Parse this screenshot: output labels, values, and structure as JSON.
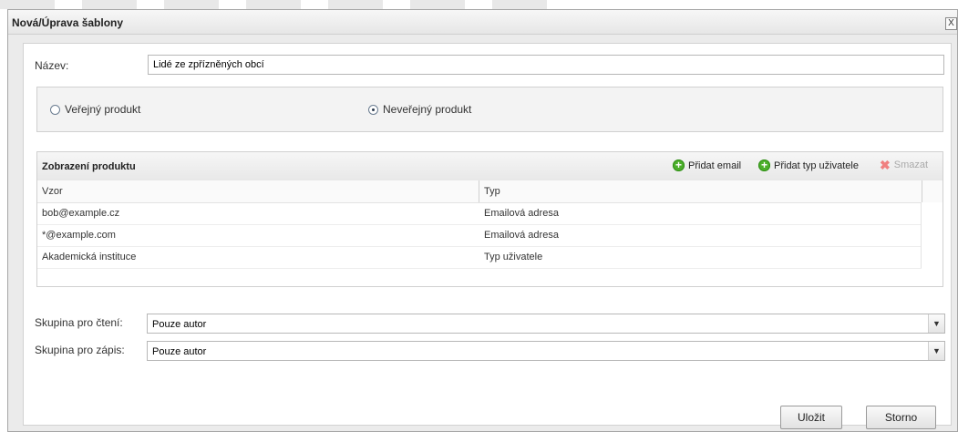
{
  "window": {
    "title": "Nová/Úprava šablony",
    "close_label": "X"
  },
  "form": {
    "name_label": "Název:",
    "name_value": "Lidé ze zpřízněných obcí",
    "radios": [
      {
        "label": "Veřejný produkt",
        "selected": false
      },
      {
        "label": "Neveřejný produkt",
        "selected": true
      }
    ]
  },
  "grid": {
    "title": "Zobrazení produktu",
    "toolbar": {
      "add_email": "Přidat email",
      "add_user_type": "Přidat typ uživatele",
      "delete": "Smazat"
    },
    "columns": [
      "Vzor",
      "Typ"
    ],
    "rows": [
      [
        "bob@example.cz",
        "Emailová adresa"
      ],
      [
        "*@example.com",
        "Emailová adresa"
      ],
      [
        "Akademická instituce",
        "Typ uživatele"
      ]
    ]
  },
  "permissions": {
    "read_label": "Skupina pro čtení:",
    "read_value": "Pouze autor",
    "write_label": "Skupina pro zápis:",
    "write_value": "Pouze autor"
  },
  "buttons": {
    "save": "Uložit",
    "cancel": "Storno"
  },
  "icons": {
    "add": "plus-circle-icon",
    "delete": "x-icon",
    "dropdown": "chevron-down-icon",
    "close": "close-icon"
  },
  "colors": {
    "add_icon": "#4caf2b",
    "delete_icon": "#f08080"
  }
}
